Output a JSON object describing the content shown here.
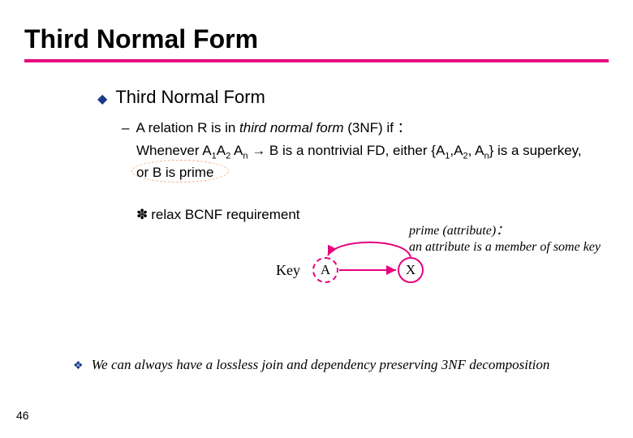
{
  "title": "Third Normal Form",
  "subtitle": "Third Normal Form",
  "definition": {
    "lead": "A relation R is in",
    "term": "third normal form",
    "tail": "(3NF) if ："
  },
  "condition": {
    "prefix": "Whenever A",
    "s1": "1",
    "a2": "A",
    "s2": "2",
    "ellip1": " ",
    "an": "A",
    "sn": "n",
    "arrow": " → ",
    "mid": "B is a nontrivial FD, either {A",
    "ls1": "1",
    "comma1": ",A",
    "ls2": "2",
    "comma2": ",  A",
    "lsn": "n",
    "after": "} is a superkey, ",
    "orB": "or B is prime"
  },
  "relax": "relax BCNF requirement",
  "primeNote": {
    "l1": "prime (attribute)：",
    "l2": "an attribute is a member of some key"
  },
  "diagram": {
    "key": "Key",
    "a": "A",
    "x": "X"
  },
  "footer": "We can always have a lossless join and dependency preserving 3NF decomposition",
  "page": "46"
}
